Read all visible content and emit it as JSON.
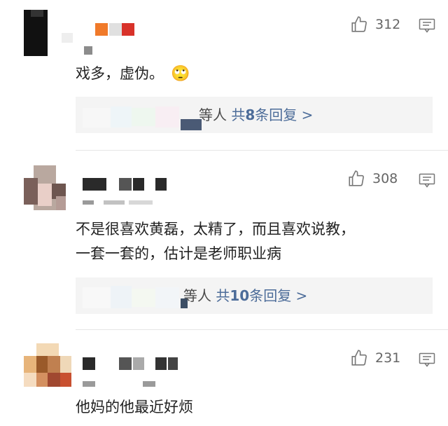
{
  "comments": [
    {
      "text_lines": [
        "戏多，虚伪。"
      ],
      "emoji": "🙄",
      "likes": "312",
      "replies": {
        "prefix": "等人",
        "count_text": "共",
        "count": "8",
        "suffix": "条回复 >"
      }
    },
    {
      "text_lines": [
        "不是很喜欢黄磊，太精了，而且喜欢说教，",
        "一套一套的，估计是老师职业病"
      ],
      "likes": "308",
      "replies": {
        "prefix": "等人",
        "count_text": "共",
        "count": "10",
        "suffix": "条回复 >"
      }
    },
    {
      "text_lines": [
        "他妈的他最近好烦"
      ],
      "likes": "231"
    }
  ],
  "icons": {
    "like": "thumbs-up-icon",
    "reply": "comment-icon"
  },
  "colors": {
    "link": "#4c6c99",
    "reply_bg": "#f4f4f4",
    "divider": "#e6e6e6"
  }
}
